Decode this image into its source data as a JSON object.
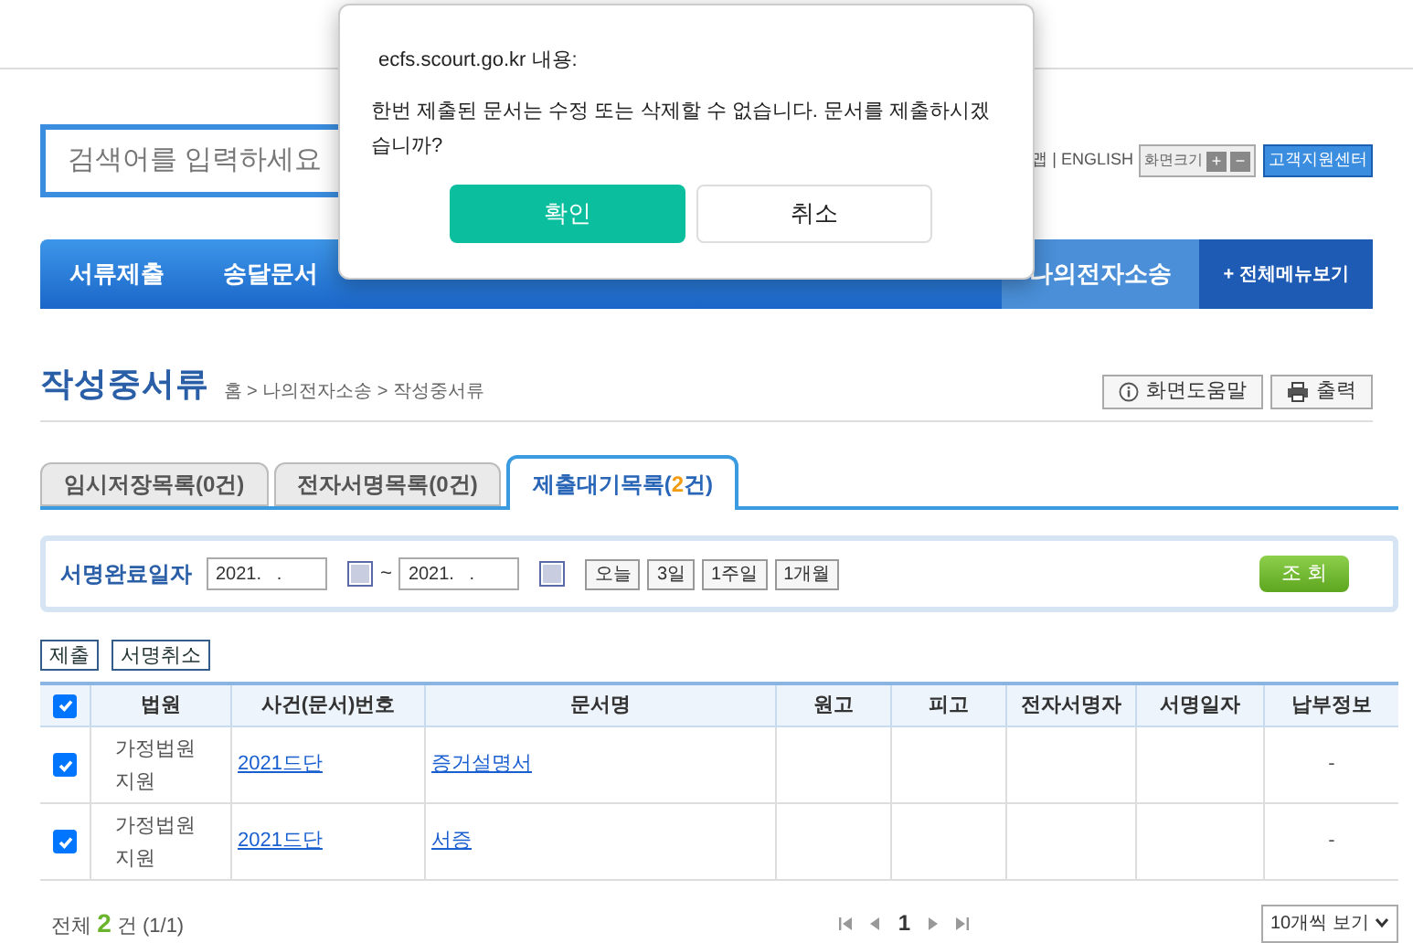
{
  "header": {
    "search": {
      "placeholder": "검색어를 입력하세요"
    },
    "links": "맵 | ENGLISH",
    "zoom_label": "화면크기",
    "zoom_in": "+",
    "zoom_out": "−",
    "support": "고객지원센터"
  },
  "nav": {
    "items": [
      {
        "label": "서류제출",
        "selected": false
      },
      {
        "label": "송달문서",
        "selected": false
      },
      {
        "label": "나의전자소송",
        "selected": true
      }
    ],
    "all_menu": "+ 전체메뉴보기"
  },
  "page": {
    "title": "작성중서류",
    "breadcrumb": "홈 > 나의전자소송 > 작성중서류",
    "help": "화면도움말",
    "print": "출력"
  },
  "tabs": [
    {
      "label": "임시저장목록(0건)",
      "selected": false
    },
    {
      "label": "전자서명목록(0건)",
      "selected": false
    },
    {
      "label": "제출대기목록(",
      "count": "2",
      "suffix": "건)",
      "selected": true
    }
  ],
  "filter": {
    "label": "서명완료일자",
    "from": "2021.   .",
    "sep": "~",
    "to": "2021.   .",
    "quick": [
      "오늘",
      "3일",
      "1주일",
      "1개월"
    ],
    "search": "조 회"
  },
  "actions": [
    "제출",
    "서명취소"
  ],
  "table": {
    "all_checked": true,
    "columns": [
      "법원",
      "사건(문서)번호",
      "문서명",
      "원고",
      "피고",
      "전자서명자",
      "서명일자",
      "납부정보"
    ],
    "rows": [
      {
        "checked": true,
        "court": "가정법원 지원",
        "case": "2021드단",
        "doc": "증거설명서",
        "payment": "-"
      },
      {
        "checked": true,
        "court": "가정법원 지원",
        "case": "2021드단",
        "doc": "서증",
        "payment": "-"
      }
    ]
  },
  "footer": {
    "total_prefix": "전체",
    "total": "2",
    "total_suffix": "건 (1/1)",
    "page": "1",
    "page_size": "10개씩 보기"
  },
  "dialog": {
    "origin": "ecfs.scourt.go.kr 내용:",
    "message": "한번 제출된 문서는 수정 또는 삭제할 수 없습니다. 문서를 제출하시겠습니까?",
    "ok": "확인",
    "cancel": "취소"
  }
}
